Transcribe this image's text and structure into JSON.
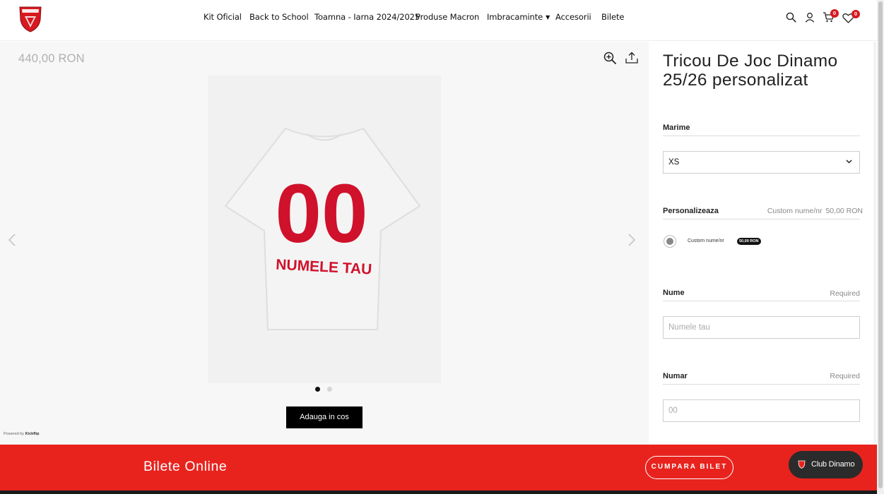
{
  "header": {
    "nav": [
      {
        "label": "Kit Oficial"
      },
      {
        "label": "Back to School"
      },
      {
        "label": "Toamna - Iarna 2024/2025"
      },
      {
        "label": "Produse Macron"
      },
      {
        "label": "Imbracaminte",
        "dropdown_icon": "caret-down-icon"
      },
      {
        "label": "Accesorii"
      },
      {
        "label": "Bilete"
      }
    ],
    "cart_count": "0",
    "wishlist_count": "0",
    "icons": [
      "search-icon",
      "user-icon",
      "cart-icon",
      "heart-icon"
    ]
  },
  "gallery": {
    "price": "440,00 RON",
    "shirt_number": "00",
    "shirt_name": "NUMELE TAU",
    "add_to_cart_label": "Adauga in cos",
    "powered_by_prefix": "Powered by",
    "powered_by_brand": "Kickflip",
    "icons": [
      "zoom-in-icon",
      "share-icon",
      "chevron-left-icon",
      "chevron-right-icon"
    ],
    "active_slide": 1,
    "slide_count": 2
  },
  "product": {
    "title": "Tricou De Joc Dinamo 25/26 personalizat",
    "size_label": "Marime",
    "size_value": "XS",
    "personalize_label": "Personalizeaza",
    "personalize_option": "Custom nume/nr",
    "personalize_price": "50,00 RON",
    "option_label": "Custom nume/nr",
    "option_price": "50,00 RON",
    "name_label": "Nume",
    "name_required": "Required",
    "name_placeholder": "Numele tau",
    "number_label": "Numar",
    "number_required": "Required",
    "number_placeholder": "00"
  },
  "footer_bar": {
    "title": "Bilete Online",
    "button_label": "CUMPARA BILET",
    "club_label": "Club Dinamo"
  },
  "colors": {
    "brand_red": "#d71920",
    "bar_red": "#e8231e",
    "button_black": "#000000"
  }
}
